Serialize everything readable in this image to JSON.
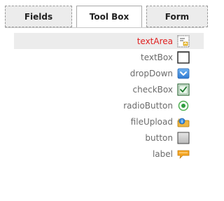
{
  "tabs": {
    "fields": "Fields",
    "toolbox": "Tool Box",
    "form": "Form"
  },
  "toolbox": {
    "items": [
      {
        "label": "textArea",
        "icon": "textarea-icon",
        "selected": true
      },
      {
        "label": "textBox",
        "icon": "textbox-icon"
      },
      {
        "label": "dropDown",
        "icon": "dropdown-icon"
      },
      {
        "label": "checkBox",
        "icon": "checkbox-icon"
      },
      {
        "label": "radioButton",
        "icon": "radiobutton-icon"
      },
      {
        "label": "fileUpload",
        "icon": "fileupload-icon"
      },
      {
        "label": "button",
        "icon": "button-icon"
      },
      {
        "label": "label",
        "icon": "label-icon"
      }
    ]
  },
  "colors": {
    "selected_text": "#e02020",
    "item_text": "#6b6b6b",
    "selected_row_bg": "#ececec"
  }
}
